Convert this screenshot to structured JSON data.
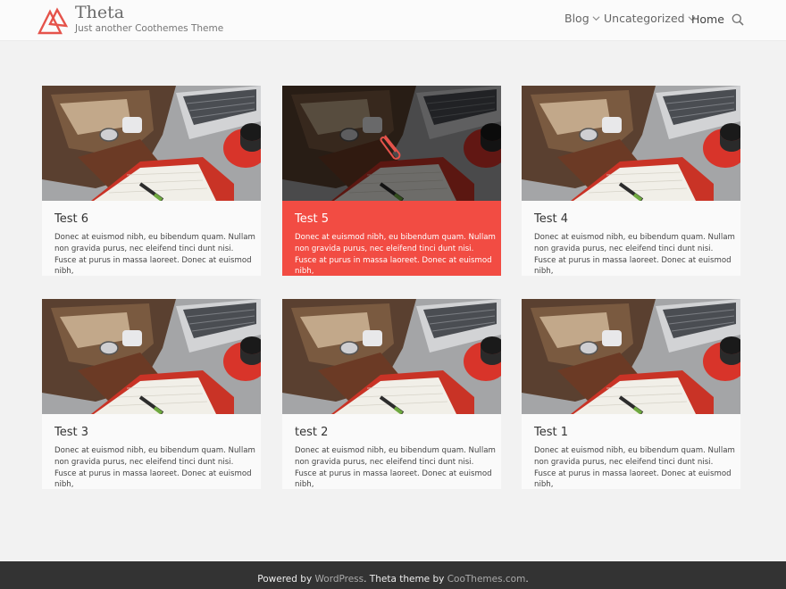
{
  "header": {
    "site_title": "Theta",
    "tagline": "Just another Coothemes Theme",
    "nav": [
      {
        "label": "Blog",
        "has_dropdown": true
      },
      {
        "label": "Uncategorized",
        "has_dropdown": true
      },
      {
        "label": "Home",
        "has_dropdown": false
      }
    ],
    "search_icon": "search-icon"
  },
  "posts": [
    {
      "title": "Test 6",
      "excerpt": "Donec at euismod nibh, eu bibendum quam. Nullam non gravida purus, nec eleifend tinci dunt nisi. Fusce at purus in massa laoreet. Donec at euismod nibh,",
      "active": false
    },
    {
      "title": "Test 5",
      "excerpt": "Donec at euismod nibh, eu bibendum quam. Nullam non gravida purus, nec eleifend tinci dunt nisi. Fusce at purus in massa laoreet. Donec at euismod nibh,",
      "active": true
    },
    {
      "title": "Test 4",
      "excerpt": "Donec at euismod nibh, eu bibendum quam. Nullam non gravida purus, nec eleifend tinci dunt nisi. Fusce at purus in massa laoreet. Donec at euismod nibh,",
      "active": false
    },
    {
      "title": "Test 3",
      "excerpt": "Donec at euismod nibh, eu bibendum quam. Nullam non gravida purus, nec eleifend tinci dunt nisi. Fusce at purus in massa laoreet. Donec at euismod nibh,",
      "active": false
    },
    {
      "title": "test 2",
      "excerpt": "Donec at euismod nibh, eu bibendum quam. Nullam non gravida purus, nec eleifend tinci dunt nisi. Fusce at purus in massa laoreet. Donec at euismod nibh,",
      "active": false
    },
    {
      "title": "Test 1",
      "excerpt": "Donec at euismod nibh, eu bibendum quam. Nullam non gravida purus, nec eleifend tinci dunt nisi. Fusce at purus in massa laoreet. Donec at euismod nibh,",
      "active": false
    }
  ],
  "footer": {
    "prefix": "Powered by ",
    "wordpress_link": "WordPress",
    "middle": ". Theta theme by ",
    "coothemes_link": "CooThemes.com",
    "suffix": "."
  },
  "colors": {
    "accent": "#f24c43",
    "logo": "#e5534b",
    "footer_bg": "#333333",
    "page_bg": "#f2f2f2"
  }
}
